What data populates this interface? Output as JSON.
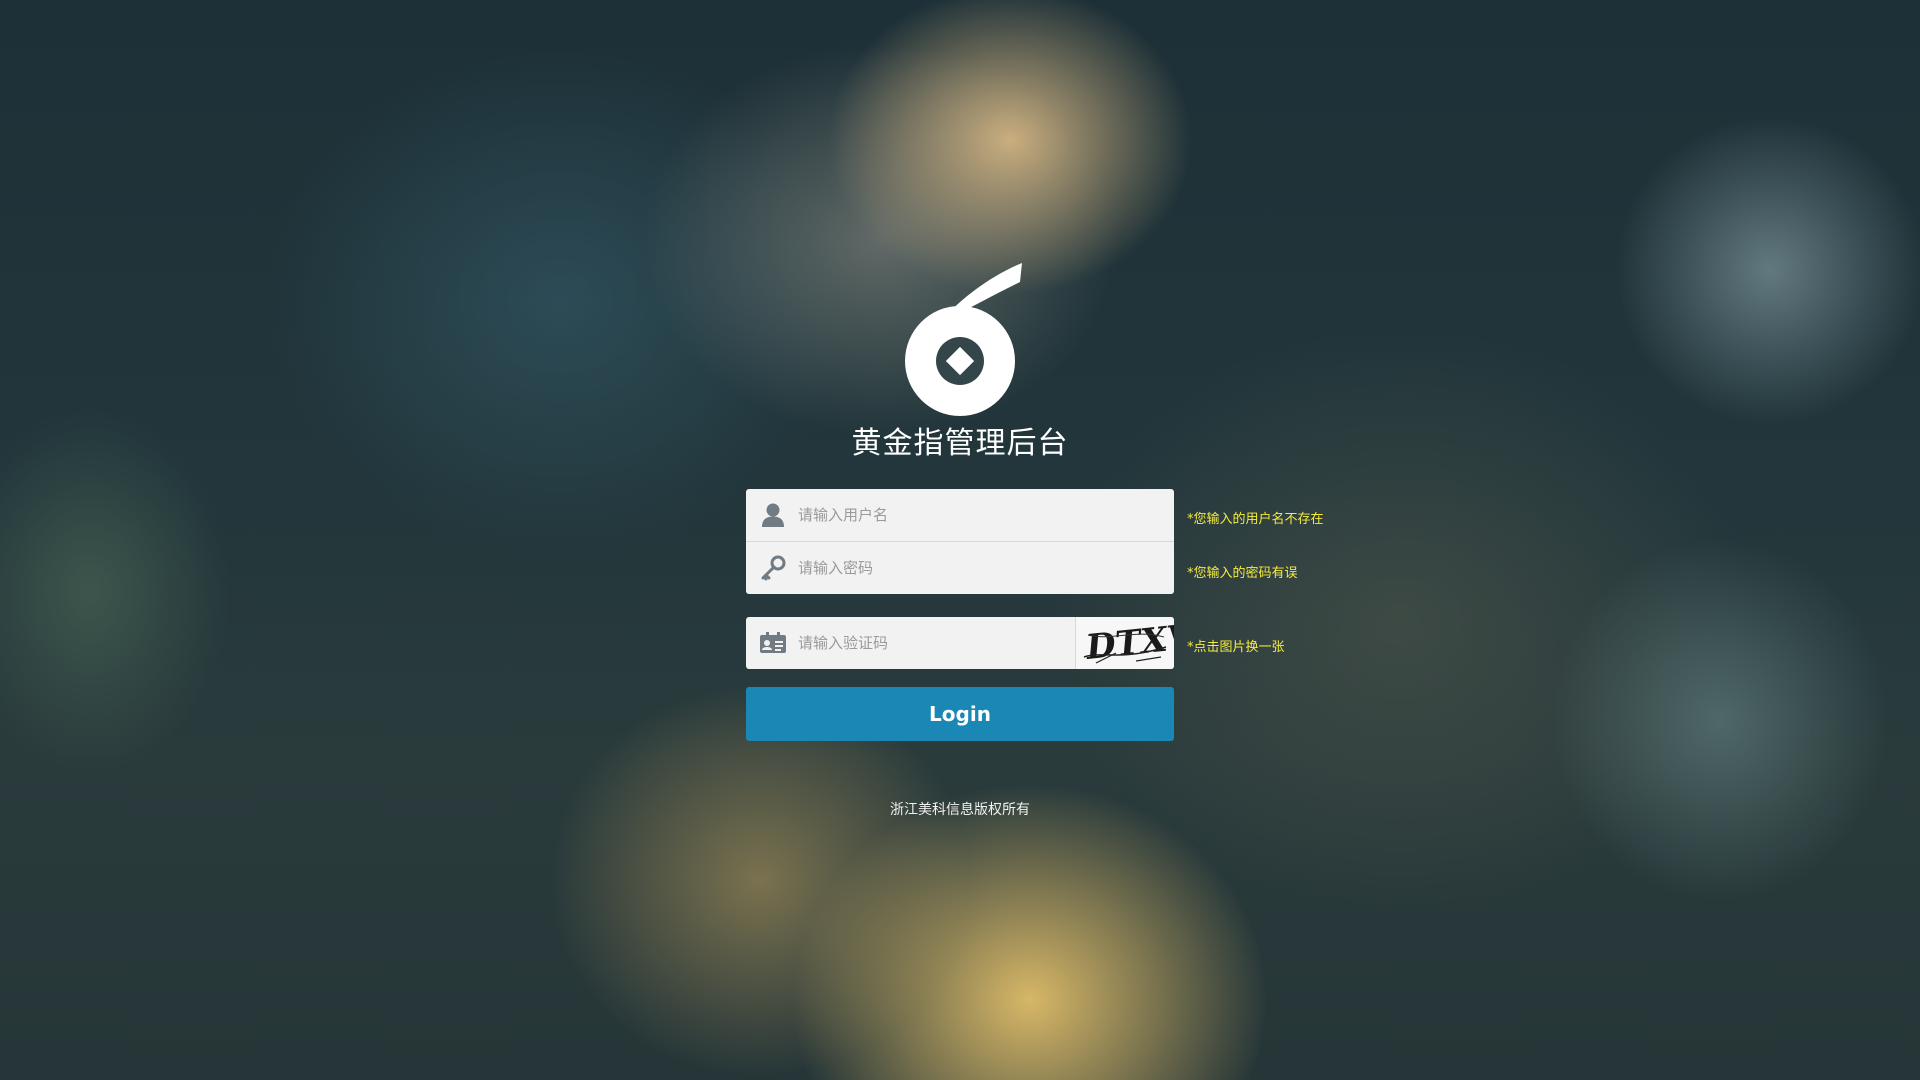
{
  "app": {
    "title": "黄金指管理后台",
    "logo_icon": "gold-finger-logo-icon"
  },
  "form": {
    "username": {
      "placeholder": "请输入用户名",
      "value": "",
      "icon": "user-icon",
      "error": "*您输入的用户名不存在"
    },
    "password": {
      "placeholder": "请输入密码",
      "value": "",
      "icon": "key-icon",
      "error": "*您输入的密码有误"
    },
    "captcha": {
      "placeholder": "请输入验证码",
      "value": "",
      "icon": "id-card-icon",
      "image_text": "DTXV",
      "hint": "*点击图片换一张"
    },
    "login_label": "Login"
  },
  "footer": {
    "copyright": "浙江美科信息版权所有"
  },
  "colors": {
    "button": "#1b87b5",
    "hint_text": "#f5ec3f",
    "input_bg": "#f2f2f2"
  }
}
